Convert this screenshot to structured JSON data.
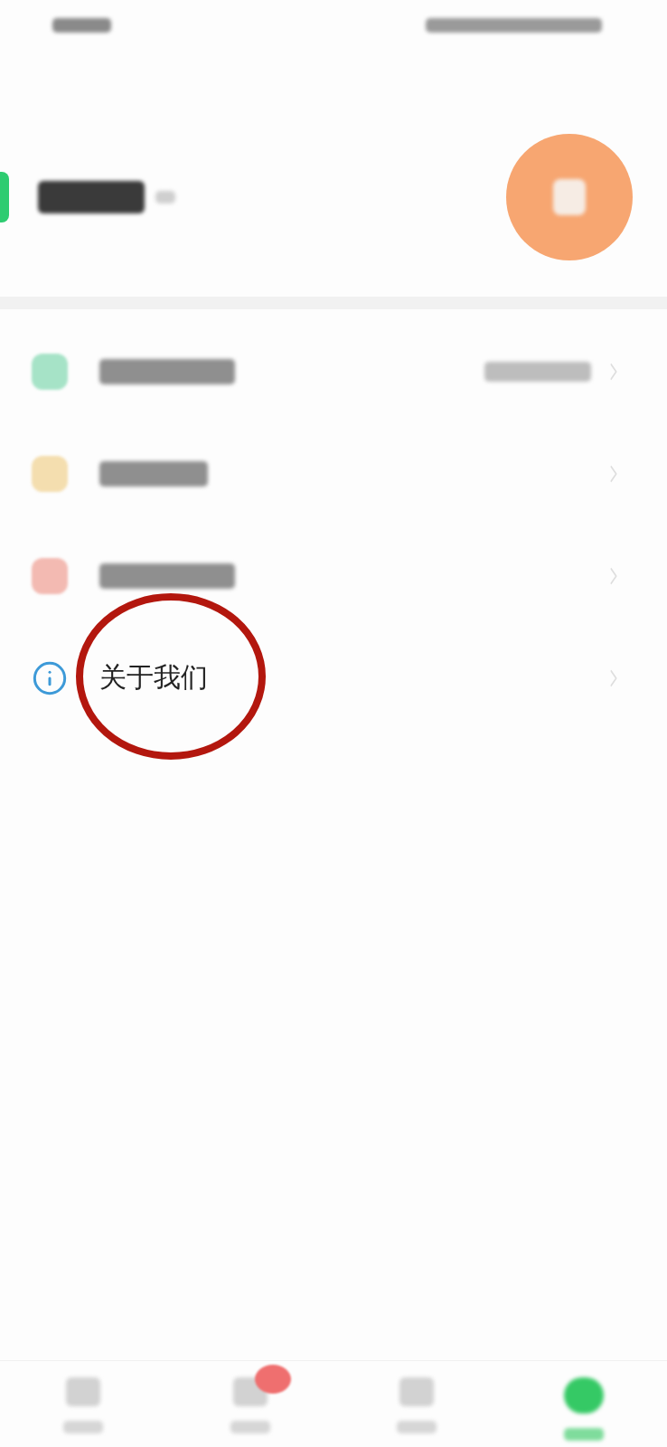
{
  "settings_rows": [
    {
      "kind": "blurred",
      "color": "#a6e3c7",
      "value_shown": true,
      "circled": false
    },
    {
      "kind": "blurred",
      "color": "#f4deaf",
      "value_shown": false,
      "circled": false
    },
    {
      "kind": "blurred",
      "color": "#f3bab2",
      "value_shown": false,
      "circled": false
    },
    {
      "kind": "text",
      "label": "关于我们",
      "color": "#3d9ad8",
      "circled": true
    }
  ],
  "tab_bar": [
    {
      "selected": false,
      "badge": false
    },
    {
      "selected": false,
      "badge": true
    },
    {
      "selected": false,
      "badge": false
    },
    {
      "selected": true,
      "badge": false
    }
  ]
}
